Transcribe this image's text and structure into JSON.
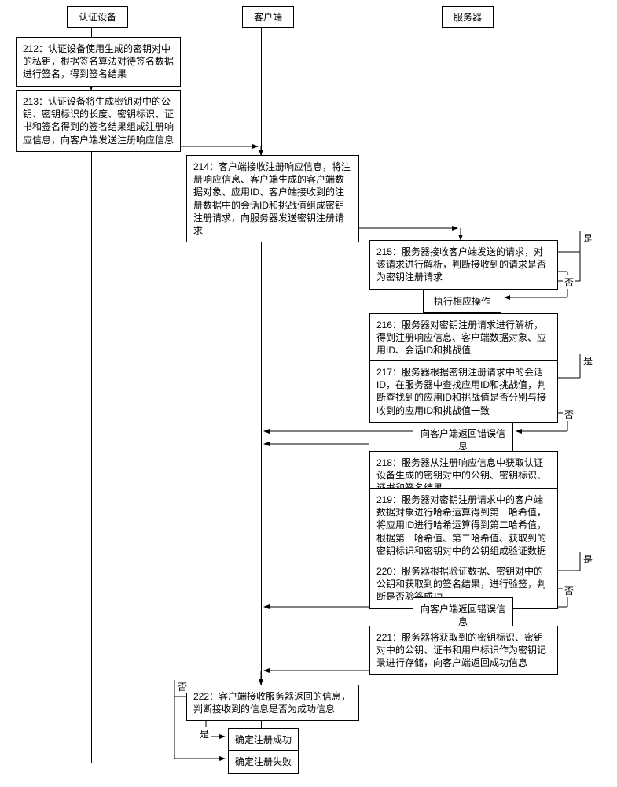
{
  "lanes": {
    "auth_device": "认证设备",
    "client": "客户端",
    "server": "服务器"
  },
  "steps": {
    "s212": "212：认证设备使用生成的密钥对中的私钥，根据签名算法对待签名数据进行签名，得到签名结果",
    "s213": "213：认证设备将生成密钥对中的公钥、密钥标识的长度、密钥标识、证书和签名得到的签名结果组成注册响应信息，向客户端发送注册响应信息",
    "s214": "214：客户端接收注册响应信息，将注册响应信息、客户端生成的客户端数据对象、应用ID、客户端接收到的注册数据中的会话ID和挑战值组成密钥注册请求，向服务器发送密钥注册请求",
    "s215": "215：服务器接收客户端发送的请求，对该请求进行解析，判断接收到的请求是否为密钥注册请求",
    "exec_op": "执行相应操作",
    "s216": "216：服务器对密钥注册请求进行解析，得到注册响应信息、客户端数据对象、应用ID、会话ID和挑战值",
    "s217": "217：服务器根据密钥注册请求中的会话ID，在服务器中查找应用ID和挑战值，判断查找到的应用ID和挑战值是否分别与接收到的应用ID和挑战值一致",
    "err_to_client_1": "向客户端返回错误信息",
    "s218": "218：服务器从注册响应信息中获取认证设备生成的密钥对中的公钥、密钥标识、证书和签名结果",
    "s219": "219：服务器对密钥注册请求中的客户端数据对象进行哈希运算得到第一哈希值，将应用ID进行哈希运算得到第二哈希值，根据第一哈希值、第二哈希值、获取到的密钥标识和密钥对中的公钥组成验证数据",
    "s220": "220：服务器根据验证数据、密钥对中的公钥和获取到的签名结果，进行验签，判断是否验签成功",
    "err_to_client_2": "向客户端返回错误信息",
    "s221": "221：服务器将获取到的密钥标识、密钥对中的公钥、证书和用户标识作为密钥记录进行存储，向客户端返回成功信息",
    "s222": "222：客户端接收服务器返回的信息，判断接收到的信息是否为成功信息",
    "reg_ok": "确定注册成功",
    "reg_fail": "确定注册失败"
  },
  "labels": {
    "yes": "是",
    "no": "否"
  }
}
